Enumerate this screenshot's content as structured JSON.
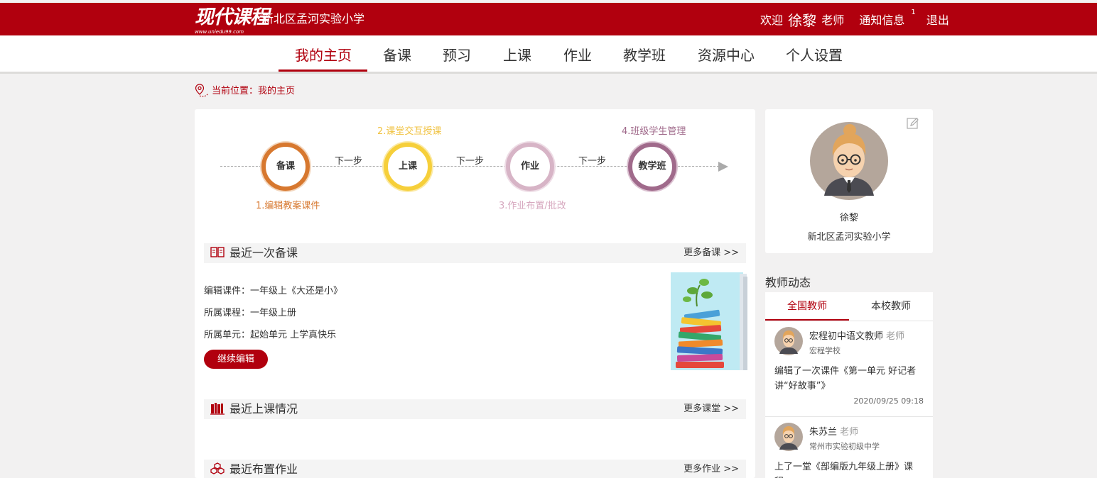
{
  "header": {
    "logo": "现代课程",
    "logo_sub": "www.uniedu99.com",
    "school": "新北区孟河实验小学",
    "welcome": "欢迎",
    "user_name": "徐黎",
    "user_role": "老师",
    "notice": "通知信息",
    "notice_count": "1",
    "logout": "退出"
  },
  "nav": {
    "items": [
      "我的主页",
      "备课",
      "预习",
      "上课",
      "作业",
      "教学班",
      "资源中心",
      "个人设置"
    ],
    "active_index": 0
  },
  "breadcrumb": "当前位置：我的主页",
  "flow": {
    "steps": [
      {
        "circle": "备课",
        "label": "1.编辑教案课件",
        "color": "#d7782f"
      },
      {
        "circle": "上课",
        "label": "2.课堂交互授课",
        "color": "#f6cf3a"
      },
      {
        "circle": "作业",
        "label": "3.作业布置/批改",
        "color": "#d7b4c6"
      },
      {
        "circle": "教学班",
        "label": "4.班级学生管理",
        "color": "#a06a8b"
      }
    ],
    "next_label": "下一步"
  },
  "recent_prep": {
    "title": "最近一次备课",
    "more": "更多备课 >>",
    "lines": [
      "编辑课件：一年级上《大还是小》",
      "所属课程：一年级上册",
      "所属单元：起始单元 上学真快乐"
    ],
    "button": "继续编辑"
  },
  "recent_class": {
    "title": "最近上课情况",
    "more": "更多课堂 >>"
  },
  "recent_homework": {
    "title": "最近布置作业",
    "more": "更多作业 >>"
  },
  "profile": {
    "name": "徐黎",
    "school": "新北区孟河实验小学"
  },
  "dynamics": {
    "title": "教师动态",
    "tabs": [
      "全国教师",
      "本校教师"
    ],
    "feed": [
      {
        "name": "宏程初中语文教师",
        "role": "老师",
        "school": "宏程学校",
        "content": "编辑了一次课件《第一单元 好记者讲“好故事”》",
        "time": "2020/09/25 09:18"
      },
      {
        "name": "朱苏兰",
        "role": "老师",
        "school": "常州市实验初级中学",
        "content": "上了一堂《部编版九年级上册》课程",
        "time": ""
      }
    ]
  },
  "colors": {
    "brand": "#b1000e",
    "background": "#f2f1f1"
  }
}
